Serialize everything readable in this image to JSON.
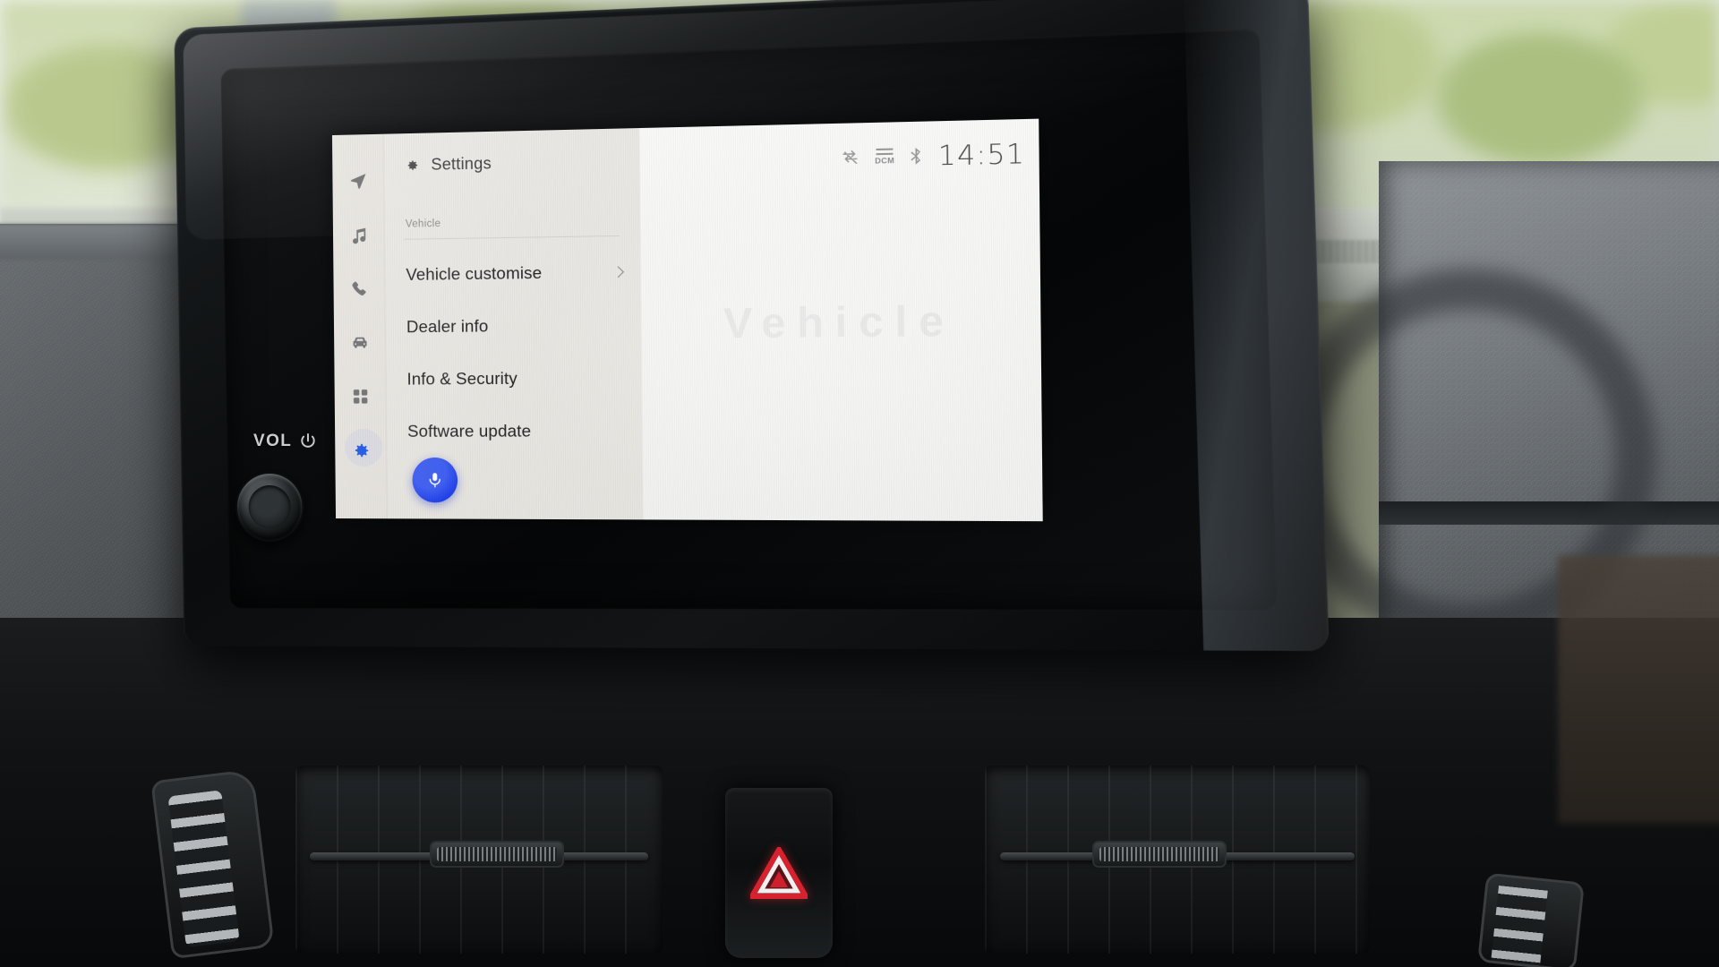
{
  "scene": {
    "description": "car-infotainment-touchscreen"
  },
  "hardware": {
    "volume_label": "VOL",
    "power_icon": "power-icon",
    "volume_knob": "volume-knob",
    "hazard_icon": "hazard-triangle-icon"
  },
  "screen": {
    "rail": {
      "items": [
        {
          "icon": "navigation-arrow-icon",
          "name": "navigation"
        },
        {
          "icon": "music-note-icon",
          "name": "media"
        },
        {
          "icon": "phone-icon",
          "name": "phone"
        },
        {
          "icon": "car-icon",
          "name": "vehicle"
        },
        {
          "icon": "apps-grid-icon",
          "name": "apps"
        },
        {
          "icon": "gear-icon",
          "name": "settings"
        }
      ],
      "active_index": 5
    },
    "header": {
      "icon": "gear-icon",
      "title": "Settings"
    },
    "section": {
      "label": "Vehicle"
    },
    "menu_items": [
      {
        "label": "Vehicle customise",
        "chevron": true
      },
      {
        "label": "Dealer info",
        "chevron": false
      },
      {
        "label": "Info & Security",
        "chevron": false
      },
      {
        "label": "Software update",
        "chevron": false
      }
    ],
    "voice_button": {
      "icon": "microphone-icon",
      "color": "#1f3fe8"
    },
    "status_bar": {
      "data_sync_icon": "data-transfer-off-icon",
      "dcm_label": "DCM",
      "dcm_icon": "dcm-signal-icon",
      "bluetooth_icon": "bluetooth-icon",
      "clock": "14:51"
    },
    "content_watermark": "Vehicle"
  },
  "colors": {
    "accent_blue": "#1f3fe8",
    "screen_bg": "#f4f3f1",
    "menu_bg": "#eae8e3",
    "rail_bg": "#e8e5e0",
    "text_primary": "#262628",
    "text_muted": "#8d8d8f",
    "hazard_red": "#cf1f2c"
  }
}
